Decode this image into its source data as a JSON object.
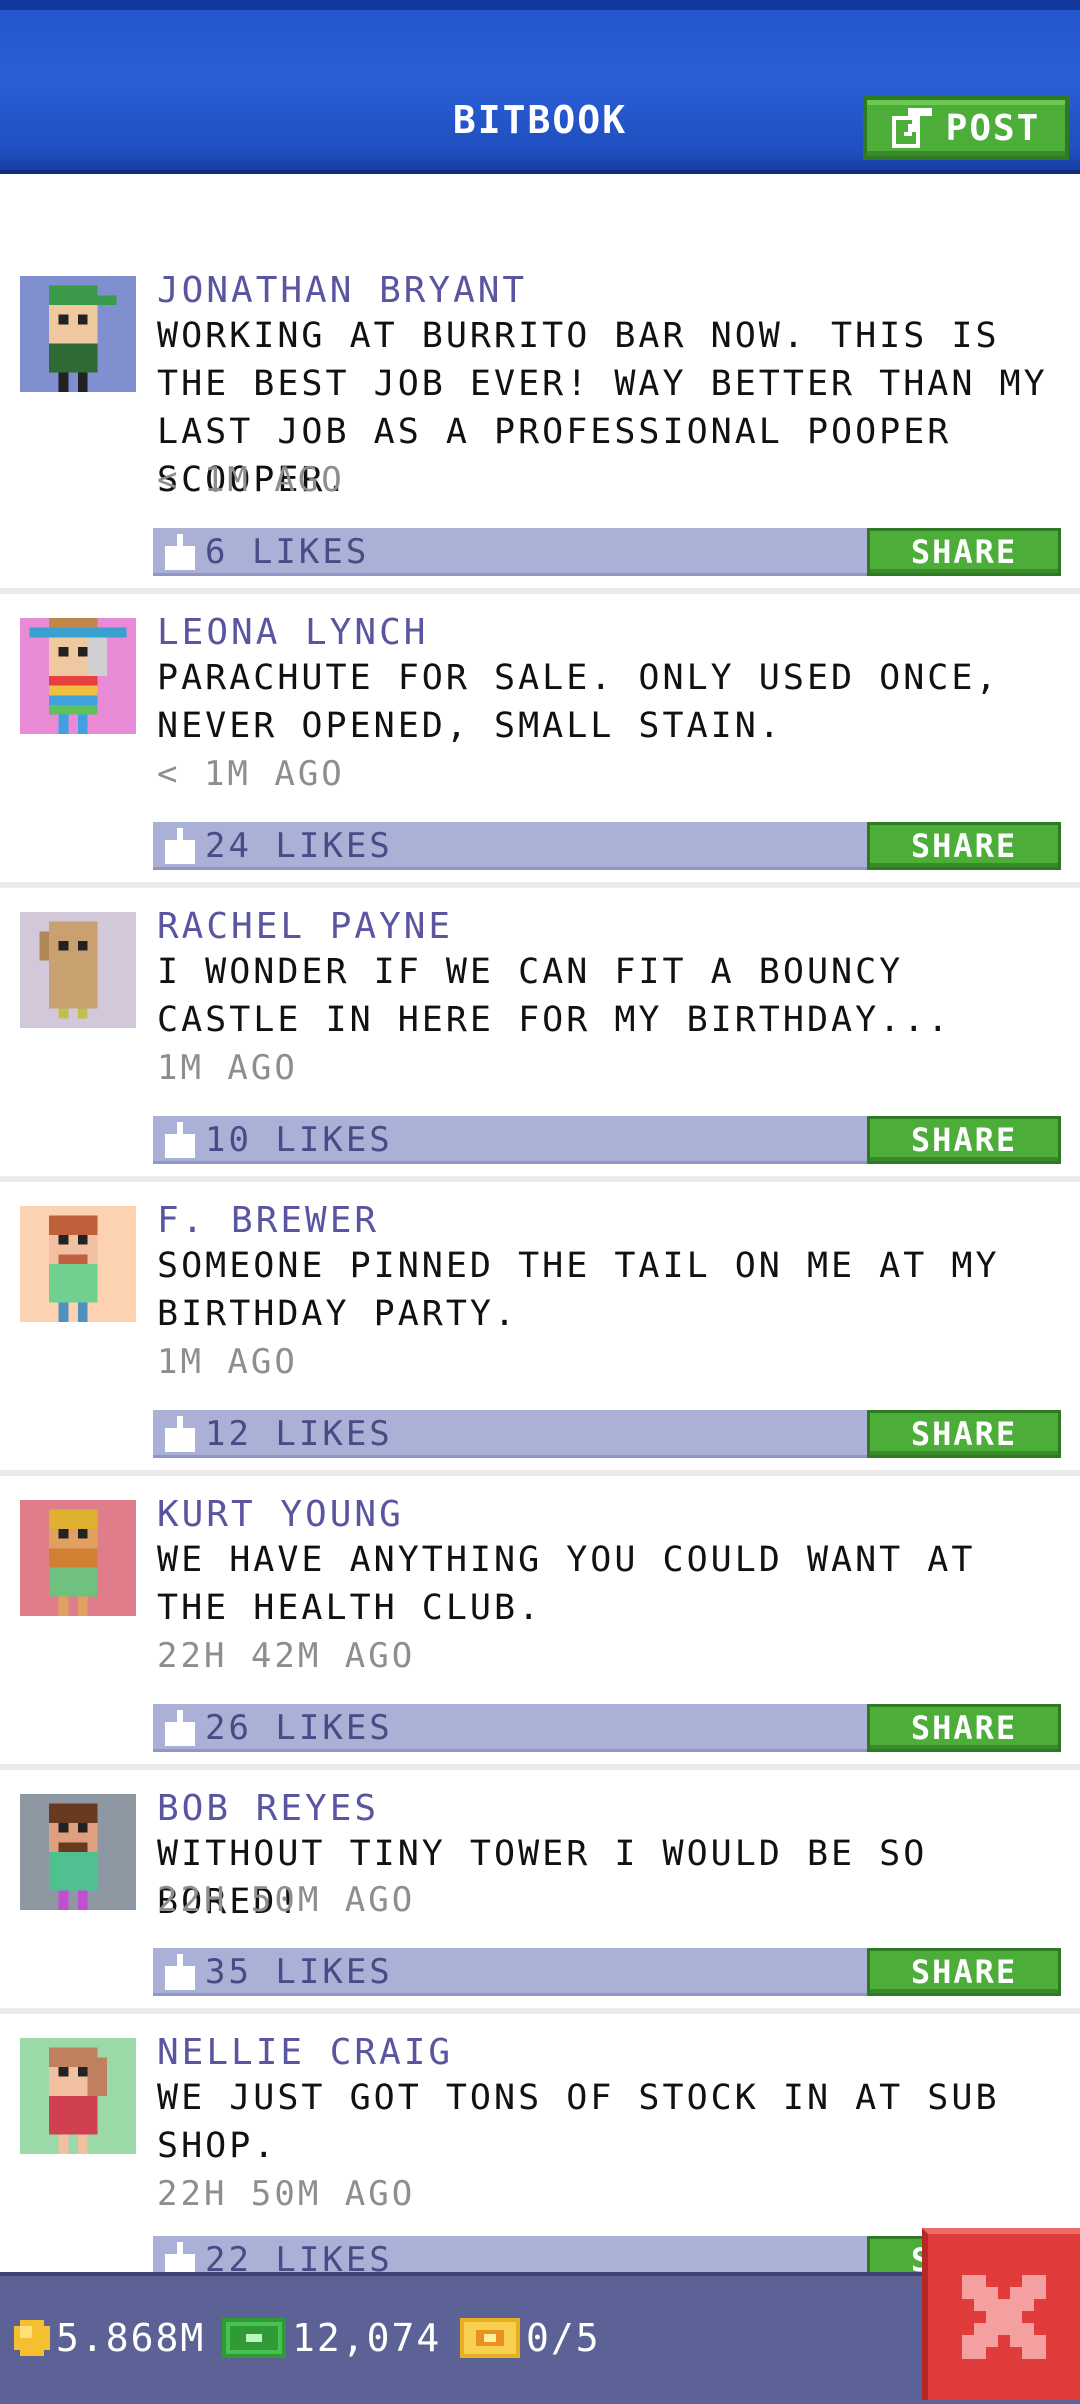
{
  "header": {
    "title": "BITBOOK",
    "post_label": "POST"
  },
  "posts": [
    {
      "name": "JONATHAN BRYANT",
      "message": "WORKING AT BURRITO BAR NOW. THIS IS THE BEST JOB EVER! WAY BETTER THAN MY LAST JOB AS A PROFESSIONAL POOPER SCOOPER.",
      "time": "< 1M AGO",
      "likes": "6 LIKES",
      "share_label": "SHARE",
      "avatar_bg": "#7f8fd0"
    },
    {
      "name": "LEONA LYNCH",
      "message": "PARACHUTE FOR SALE. ONLY USED ONCE, NEVER OPENED, SMALL STAIN.",
      "time": "< 1M AGO",
      "likes": "24 LIKES",
      "share_label": "SHARE",
      "avatar_bg": "#e88ad6"
    },
    {
      "name": "RACHEL PAYNE",
      "message": "I WONDER IF WE CAN FIT A BOUNCY CASTLE IN HERE FOR MY BIRTHDAY...",
      "time": "1M AGO",
      "likes": "10 LIKES",
      "share_label": "SHARE",
      "avatar_bg": "#d3c8d9"
    },
    {
      "name": "F. BREWER",
      "message": "SOMEONE PINNED THE TAIL ON ME AT MY BIRTHDAY PARTY.",
      "time": "1M AGO",
      "likes": "12 LIKES",
      "share_label": "SHARE",
      "avatar_bg": "#fdd2b0"
    },
    {
      "name": "KURT YOUNG",
      "message": "WE HAVE ANYTHING YOU COULD WANT AT THE HEALTH CLUB.",
      "time": "22H 42M AGO",
      "likes": "26 LIKES",
      "share_label": "SHARE",
      "avatar_bg": "#e07d8a"
    },
    {
      "name": "BOB REYES",
      "message": "WITHOUT TINY TOWER I WOULD BE SO BORED!",
      "time": "22H 50M AGO",
      "likes": "35 LIKES",
      "share_label": "SHARE",
      "avatar_bg": "#8e98a3"
    },
    {
      "name": "NELLIE CRAIG",
      "message": "WE JUST GOT TONS OF STOCK IN AT SUB SHOP.",
      "time": "22H 50M AGO",
      "likes": "22 LIKES",
      "share_label": "SHARE",
      "avatar_bg": "#9bd9a8"
    }
  ],
  "footer": {
    "coins": "5.868M",
    "bux": "12,074",
    "tickets": "0/5"
  },
  "colors": {
    "accent_blue": "#2a5fd6",
    "share_green": "#4cad39",
    "like_bar": "#aab0d6",
    "close_red": "#e13c3c"
  }
}
